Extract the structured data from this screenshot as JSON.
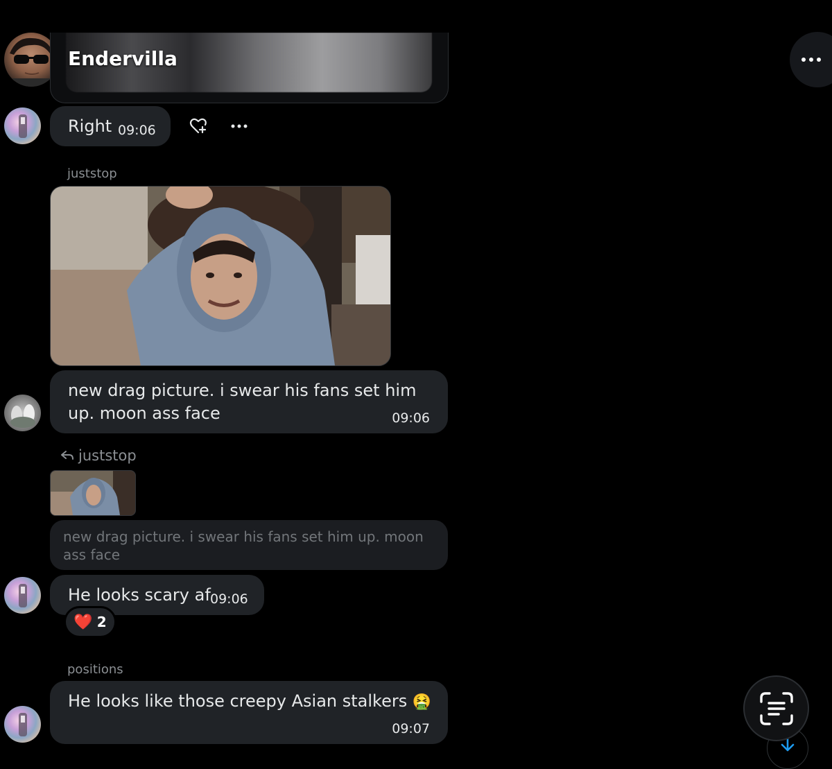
{
  "colors": {
    "background": "#000000",
    "bubble": "#202327",
    "muted_text": "#8b8f93",
    "reply_quote_text": "#72767a",
    "accent_blue": "#1d9bf0",
    "heart": "#e0245e"
  },
  "top_message": {
    "sender_name": "Endervilla"
  },
  "top_more": {
    "icon": "more-horizontal-icon"
  },
  "messages": [
    {
      "text": "Right",
      "time": "09:06",
      "actions": {
        "react_icon": "heart-plus-icon",
        "more_icon": "more-horizontal-icon"
      }
    },
    {
      "username": "juststop",
      "text": "new drag picture. i swear his fans set him up. moon ass face",
      "time": "09:06"
    },
    {
      "reply_to": "juststop",
      "quoted_text": "new drag picture. i swear his fans set him up. moon ass face",
      "text": "He looks scary af",
      "time": "09:06",
      "reaction": {
        "emoji": "❤️",
        "count": "2"
      }
    },
    {
      "username": "positions",
      "text": "He looks like those creepy Asian stalkers",
      "emoji": "🤮",
      "time": "09:07"
    }
  ],
  "floating": {
    "scan_icon": "text-scan-icon",
    "scroll_down_icon": "arrow-down-icon"
  }
}
